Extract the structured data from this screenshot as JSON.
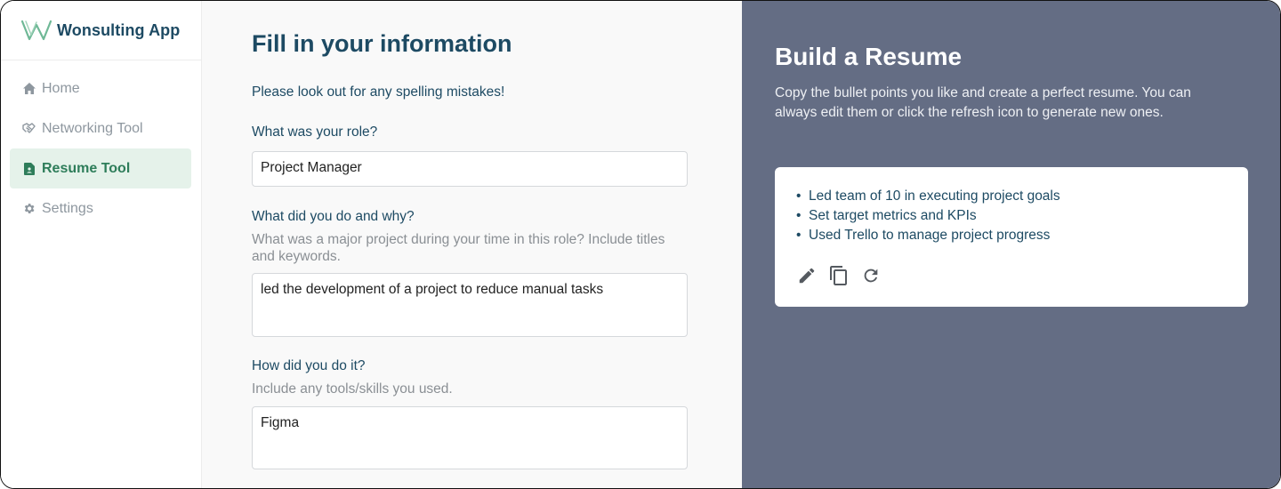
{
  "app": {
    "name": "Wonsulting App"
  },
  "sidebar": {
    "items": [
      {
        "label": "Home",
        "icon": "home-icon"
      },
      {
        "label": "Networking Tool",
        "icon": "handshake-icon"
      },
      {
        "label": "Resume Tool",
        "icon": "document-icon",
        "active": true
      },
      {
        "label": "Settings",
        "icon": "gear-icon"
      }
    ]
  },
  "form": {
    "title": "Fill in your information",
    "notice": "Please look out for any spelling mistakes!",
    "role": {
      "label": "What was your role?",
      "value": "Project Manager"
    },
    "what": {
      "label": "What did you do and why?",
      "help": "What was a major project during your time in this role? Include titles and keywords.",
      "value": "led the development of a project to reduce manual tasks"
    },
    "how": {
      "label": "How did you do it?",
      "help": "Include any tools/skills you used.",
      "value": "Figma"
    }
  },
  "panel": {
    "title": "Build a Resume",
    "description": "Copy the bullet points you like and create a perfect resume. You can always edit them or click the refresh icon to generate new ones.",
    "bullets": [
      "Led team of 10 in executing project goals",
      "Set target metrics and KPIs",
      "Used Trello to manage project progress"
    ],
    "actions": [
      "pencil-icon",
      "copy-icon",
      "refresh-icon"
    ]
  },
  "colors": {
    "brand": "#1d4a63",
    "active_bg": "#e5f2ea",
    "active_text": "#2e7d5a",
    "panel_bg": "#646d84"
  }
}
